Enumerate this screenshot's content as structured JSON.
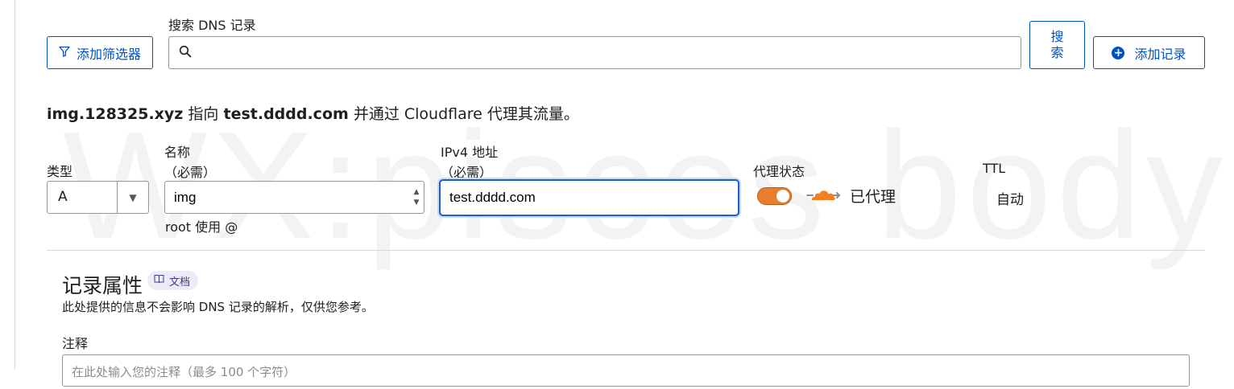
{
  "watermark": "WX:pisces body",
  "toolbar": {
    "filter_label": "添加筛选器",
    "search_label": "搜索 DNS 记录",
    "search_value": "",
    "search_button_line1": "搜",
    "search_button_line2": "索",
    "add_record_label": "添加记录"
  },
  "summary": {
    "name": "img.128325.xyz",
    "points_to": "指向",
    "target": "test.dddd.com",
    "rest": "并通过 Cloudflare 代理其流量。"
  },
  "form": {
    "type_label": "类型",
    "type_value": "A",
    "name_label": "名称",
    "name_required": "（必需）",
    "name_value": "img",
    "name_hint": "root 使用 @",
    "ipv4_label": "IPv4 地址",
    "ipv4_required": "（必需）",
    "ipv4_value": "test.dddd.com",
    "proxy_label": "代理状态",
    "proxy_on": true,
    "proxy_status_text": "已代理",
    "ttl_label": "TTL",
    "ttl_value": "自动"
  },
  "record_props": {
    "title": "记录属性",
    "doc_badge": "文档",
    "description": "此处提供的信息不会影响 DNS 记录的解析，仅供您参考。",
    "comment_label": "注释",
    "comment_placeholder": "在此处输入您的注释（最多 100 个字符）"
  },
  "colors": {
    "accent": "#0051c3",
    "proxy_orange": "#f38020",
    "focus_border": "#1a5fd0"
  }
}
